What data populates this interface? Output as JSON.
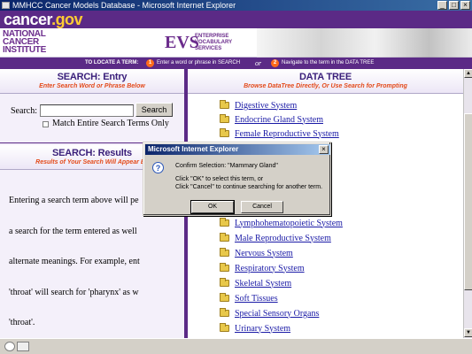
{
  "window": {
    "title": "MMHCC Cancer Models Database - Microsoft Internet Explorer",
    "buttons": [
      "_",
      "□",
      "×"
    ]
  },
  "banner": {
    "logo_name": "cancer",
    "logo_dot": ".gov"
  },
  "header": {
    "nci_logo": [
      "NATIONAL",
      "CANCER",
      "INSTITUTE"
    ],
    "evs": "EVS",
    "evs_sub": [
      "ENTERPRISE",
      "VOCABULARY",
      "SERVICES"
    ]
  },
  "instructions": {
    "prefix": "TO LOCATE A TERM:",
    "step1_num": "1",
    "step1": "Enter a word or phrase in SEARCH",
    "or": "or",
    "step2_num": "2",
    "step2": "Navigate to the term in the DATA TREE"
  },
  "search_entry": {
    "heading_a": "SEARCH:",
    "heading_b": "Entry",
    "subheading": "Enter Search Word or Phrase Below",
    "label": "Search:",
    "input_value": "",
    "button": "Search",
    "checkbox_label": "Match Entire Search Terms Only",
    "checkbox_checked": false
  },
  "search_results": {
    "heading_a": "SEARCH:",
    "heading_b": "Results",
    "subheading": "Results of Your Search Will Appear Be",
    "lines": [
      "Entering a search term above will pe",
      "a search for the term entered as well",
      "alternate meanings. For example, ent",
      "'throat' will search for 'pharynx' as w",
      "'throat'."
    ]
  },
  "data_tree": {
    "heading": "DATA TREE",
    "subheading": "Browse DataTree Directly, Or Use Search for Prompting",
    "items": [
      "Digestive System",
      "Endocrine Gland System",
      "Female Reproductive System",
      "Lymphohematopoietic System",
      "Male Reproductive System",
      "Nervous System",
      "Respiratory System",
      "Skeletal System",
      "Soft Tissues",
      "Special Sensory Organs",
      "Urinary System"
    ]
  },
  "dialog": {
    "title": "Microsoft Internet Explorer",
    "close": "×",
    "icon": "?",
    "message": "Confirm Selection: \"Mammary Gland\"",
    "line2": "Click \"OK\" to select this term, or",
    "line3": "Click \"Cancel\" to continue searching for another term.",
    "ok": "OK",
    "cancel": "Cancel"
  },
  "colors": {
    "brand_purple": "#5b2a86",
    "accent_orange": "#e34a1a",
    "link_blue": "#1a1aa6"
  }
}
